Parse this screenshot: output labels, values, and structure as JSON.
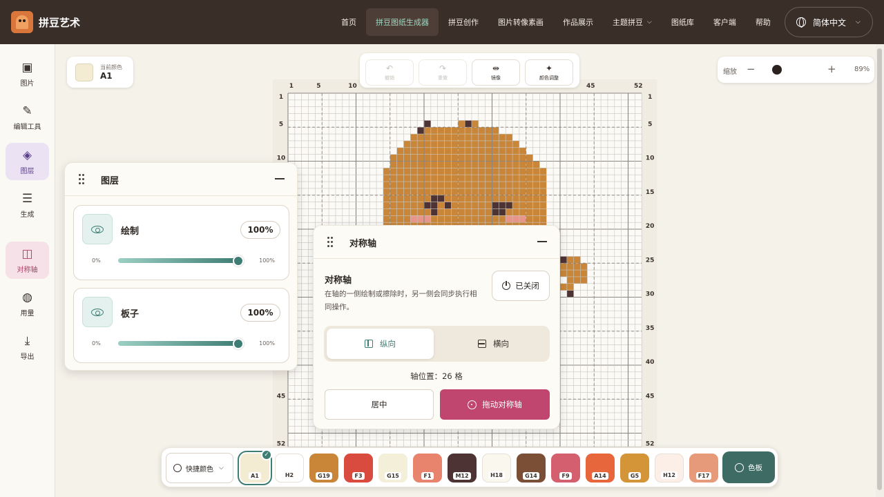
{
  "brand": {
    "name": "拼豆艺术"
  },
  "nav": {
    "items": [
      {
        "label": "首页"
      },
      {
        "label": "拼豆图纸生成器",
        "active": true
      },
      {
        "label": "拼豆创作"
      },
      {
        "label": "图片转像素画"
      },
      {
        "label": "作品展示"
      },
      {
        "label": "主题拼豆",
        "dropdown": true
      },
      {
        "label": "图纸库"
      },
      {
        "label": "客户端"
      },
      {
        "label": "帮助"
      }
    ],
    "language": "简体中文"
  },
  "sidebar": {
    "items": [
      {
        "label": "图片",
        "icon": "image-icon"
      },
      {
        "label": "编辑工具",
        "icon": "brush-icon"
      },
      {
        "label": "图层",
        "icon": "layers-icon",
        "active": true
      },
      {
        "label": "生成",
        "icon": "sliders-icon"
      },
      {
        "label": "对称轴",
        "icon": "symmetry-icon",
        "active": true
      },
      {
        "label": "用量",
        "icon": "palette-icon"
      },
      {
        "label": "导出",
        "icon": "download-icon"
      }
    ]
  },
  "current_color": {
    "label": "当前颜色",
    "code": "A1",
    "color": "#f3ecd2"
  },
  "toolbar": {
    "undo": "撤销",
    "redo": "重做",
    "mirror": "镜像",
    "color_adjust": "颜色调整"
  },
  "zoom": {
    "label": "缩放",
    "value": "89%",
    "level": 0.89
  },
  "grid": {
    "columns": 52,
    "rows": 52,
    "col_labels": [
      "1",
      "5",
      "10",
      "45",
      "52"
    ],
    "row_labels": [
      "1",
      "5",
      "10",
      "15",
      "20",
      "25",
      "30",
      "35",
      "40",
      "45",
      "52"
    ]
  },
  "layers_panel": {
    "title": "图层",
    "layers": [
      {
        "name": "绘制",
        "opacity": "100%",
        "min": "0%",
        "max": "100%"
      },
      {
        "name": "板子",
        "opacity": "100%",
        "min": "0%",
        "max": "100%"
      }
    ]
  },
  "symmetry_panel": {
    "title": "对称轴",
    "subtitle": "对称轴",
    "description": "在轴的一侧绘制或擦除时，另一侧会同步执行相同操作。",
    "toggle": "已关闭",
    "vertical": "纵向",
    "horizontal": "横向",
    "axis_position": "轴位置：26 格",
    "center_button": "居中",
    "drag_button": "拖动对称轴"
  },
  "palette": {
    "quick_label": "快捷颜色",
    "palette_button": "色板",
    "colors": [
      {
        "code": "A1",
        "hex": "#f3ecd2",
        "selected": true
      },
      {
        "code": "H2",
        "hex": "#ffffff"
      },
      {
        "code": "G19",
        "hex": "#c98639"
      },
      {
        "code": "F3",
        "hex": "#d94a3f"
      },
      {
        "code": "G15",
        "hex": "#f3efd9"
      },
      {
        "code": "F1",
        "hex": "#e8836e"
      },
      {
        "code": "M12",
        "hex": "#4e3334"
      },
      {
        "code": "H18",
        "hex": "#faf7ee"
      },
      {
        "code": "G14",
        "hex": "#7b4f36"
      },
      {
        "code": "F9",
        "hex": "#d45f6e"
      },
      {
        "code": "A14",
        "hex": "#e8663c"
      },
      {
        "code": "G5",
        "hex": "#d49538"
      },
      {
        "code": "H12",
        "hex": "#fbefe7"
      },
      {
        "code": "F17",
        "hex": "#e79a7a"
      }
    ]
  }
}
